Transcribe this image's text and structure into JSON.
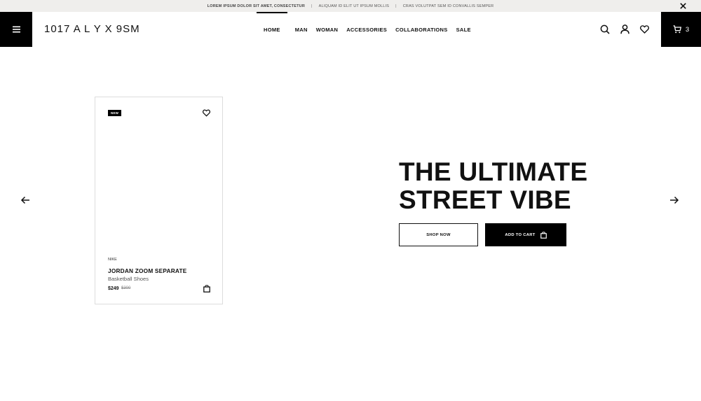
{
  "announcement": {
    "messages": [
      "LOREM IPSUM DOLOR SIT AMET, CONSECTETUR",
      "ALIQUAM ID ELIT UT IPSUM MOLLIS",
      "CRAS VOLUTPAT SEM ID CONVALLIS SEMPER"
    ],
    "separator": "|",
    "close_icon": "close-icon"
  },
  "header": {
    "logo": "1017 A L Y X 9SM",
    "nav": [
      "HOME",
      "MAN",
      "WOMAN",
      "ACCESSORIES",
      "COLLABORATIONS",
      "SALE"
    ],
    "active_nav": "HOME",
    "icons": [
      "search-icon",
      "user-icon",
      "heart-icon"
    ],
    "cart_count": "3"
  },
  "product": {
    "badge": "NEW",
    "brand": "NIKE",
    "name": "JORDAN ZOOM SEPARATE",
    "category": "Basketball Shoes",
    "price": "$249",
    "old_price": "$300"
  },
  "hero": {
    "title_line1": "THE ULTIMATE",
    "title_line2": "STREET VIBE",
    "shop_button": "SHOP NOW",
    "cart_button": "ADD TO CART"
  },
  "colors": {
    "primary": "#000000",
    "background": "#ffffff",
    "announcement_bg": "#efeeec"
  }
}
